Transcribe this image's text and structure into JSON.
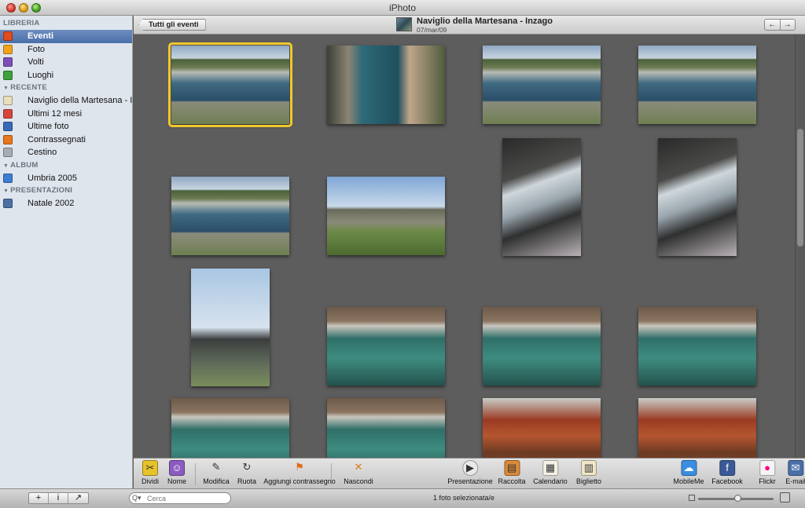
{
  "window": {
    "title": "iPhoto"
  },
  "sidebar": {
    "sections": [
      {
        "title": "LIBRERIA",
        "items": [
          {
            "label": "Eventi",
            "icon": "events-icon",
            "color": "#e04b1f",
            "selected": true
          },
          {
            "label": "Foto",
            "icon": "photos-icon",
            "color": "#f1a31e"
          },
          {
            "label": "Volti",
            "icon": "faces-icon",
            "color": "#7c4fb6"
          },
          {
            "label": "Luoghi",
            "icon": "places-icon",
            "color": "#3ea13c"
          }
        ]
      },
      {
        "title": "RECENTE",
        "items": [
          {
            "label": "Naviglio della Martesana - I...",
            "icon": "event-album-icon",
            "color": "#e7dfb8"
          },
          {
            "label": "Ultimi 12 mesi",
            "icon": "calendar-icon",
            "color": "#d4463a"
          },
          {
            "label": "Ultime foto",
            "icon": "import-icon",
            "color": "#3869b8"
          },
          {
            "label": "Contrassegnati",
            "icon": "flag-icon",
            "color": "#e8771f"
          },
          {
            "label": "Cestino",
            "icon": "trash-icon",
            "color": "#a8acb3"
          }
        ]
      },
      {
        "title": "ALBUM",
        "items": [
          {
            "label": "Umbria 2005",
            "icon": "album-icon",
            "color": "#3d7ed4"
          }
        ]
      },
      {
        "title": "PRESENTAZIONI",
        "items": [
          {
            "label": "Natale 2002",
            "icon": "slideshow-icon",
            "color": "#4d6fa3"
          }
        ]
      }
    ]
  },
  "topbar": {
    "back_label": "Tutti gli eventi",
    "event_title": "Naviglio della Martesana - Inzago",
    "event_date": "07/mar/09",
    "prev": "←",
    "next": "→"
  },
  "photos": [
    {
      "scene": "lock-canal",
      "orientation": "landscape",
      "selected": true
    },
    {
      "scene": "canal-gates",
      "orientation": "landscape"
    },
    {
      "scene": "lock-canal",
      "orientation": "landscape"
    },
    {
      "scene": "lock-canal",
      "orientation": "landscape"
    },
    {
      "scene": "lock-canal",
      "orientation": "landscape"
    },
    {
      "scene": "canal-path",
      "orientation": "landscape"
    },
    {
      "scene": "bridge-stairs",
      "orientation": "portrait"
    },
    {
      "scene": "bridge-stairs",
      "orientation": "portrait"
    },
    {
      "scene": "iron-post",
      "orientation": "portrait"
    },
    {
      "scene": "green-water",
      "orientation": "landscape"
    },
    {
      "scene": "green-water",
      "orientation": "landscape"
    },
    {
      "scene": "green-water",
      "orientation": "landscape"
    },
    {
      "scene": "green-water",
      "orientation": "landscape"
    },
    {
      "scene": "green-water",
      "orientation": "landscape"
    },
    {
      "scene": "rusty-gate",
      "orientation": "landscape"
    },
    {
      "scene": "rusty-gate",
      "orientation": "landscape"
    }
  ],
  "toolbar": {
    "left": [
      {
        "label": "Dividi",
        "icon": "split-icon"
      },
      {
        "label": "Nome",
        "icon": "name-icon"
      },
      {
        "label": "Modifica",
        "icon": "edit-icon"
      },
      {
        "label": "Ruota",
        "icon": "rotate-icon"
      },
      {
        "label": "Aggiungi contrassegno",
        "icon": "flag-icon"
      },
      {
        "label": "Nascondi",
        "icon": "hide-icon"
      }
    ],
    "center": [
      {
        "label": "Presentazione",
        "icon": "play-icon"
      },
      {
        "label": "Raccolta",
        "icon": "book-icon"
      },
      {
        "label": "Calendario",
        "icon": "calendar-icon"
      },
      {
        "label": "Biglietto",
        "icon": "card-icon"
      }
    ],
    "right": [
      {
        "label": "MobileMe",
        "icon": "mobileme-icon",
        "color": "#3a8ee0"
      },
      {
        "label": "Facebook",
        "icon": "facebook-icon",
        "color": "#3b5998"
      },
      {
        "label": "Flickr",
        "icon": "flickr-icon",
        "color": "#ff0084"
      },
      {
        "label": "E-mail",
        "icon": "email-icon",
        "color": "#4a6fa9"
      }
    ]
  },
  "statusbar": {
    "add": "+",
    "info": "i",
    "fullscreen": "↗",
    "search_placeholder": "Cerca",
    "search_icon": "Q▾",
    "status": "1 foto selezionata/e"
  }
}
